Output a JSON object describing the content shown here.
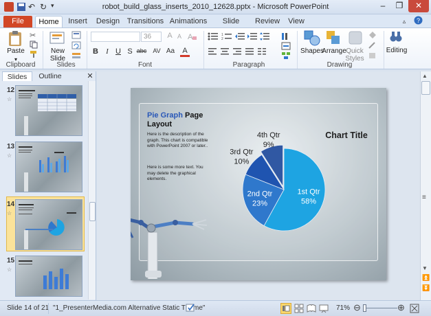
{
  "window": {
    "title": "robot_build_glass_inserts_2010_12628.pptx - Microsoft PowerPoint",
    "minimize_icon": "minimize-icon",
    "restore_icon": "restore-icon",
    "close_icon": "close-icon"
  },
  "ribbon_tabs": [
    "File",
    "Home",
    "Insert",
    "Design",
    "Transitions",
    "Animations",
    "Slide Show",
    "Review",
    "View"
  ],
  "ribbon": {
    "groups": [
      "Clipboard",
      "Slides",
      "Font",
      "Paragraph",
      "Drawing"
    ],
    "paste_label": "Paste",
    "new_slide_label": "New Slide",
    "font_size": "36",
    "shapes_label": "Shapes",
    "arrange_label": "Arrange",
    "quick_styles_label": "Quick Styles",
    "editing_label": "Editing",
    "format_buttons": [
      "B",
      "I",
      "U",
      "S",
      "abc",
      "AV",
      "Aa",
      "A"
    ]
  },
  "pane_tabs": {
    "slides": "Slides",
    "outline": "Outline"
  },
  "thumbnails": [
    {
      "number": "12"
    },
    {
      "number": "13"
    },
    {
      "number": "14",
      "selected": true
    },
    {
      "number": "15"
    }
  ],
  "slide": {
    "title_blue": "Pie Graph",
    "title_black": " Page Layout",
    "desc1": "Here is the description of the graph.  This chart is compatible with PowerPoint 2007 or later..",
    "desc2": "Here is some more text.  You may delete the graphical elements.",
    "chart_title": "Chart Title"
  },
  "chart_data": {
    "type": "pie",
    "title": "Chart Title",
    "slices": [
      {
        "label": "1st Qtr",
        "value": 58,
        "pct": "58%",
        "color": "#1ea4e2"
      },
      {
        "label": "2nd Qtr",
        "value": 23,
        "pct": "23%",
        "color": "#2f78cc"
      },
      {
        "label": "3rd Qtr",
        "value": 10,
        "pct": "10%",
        "color": "#1f54b0"
      },
      {
        "label": "4th Qtr",
        "value": 9,
        "pct": "9%",
        "color": "#3058a3"
      }
    ]
  },
  "status": {
    "slide_info": "Slide 14 of 21",
    "theme": "\"1_PresenterMedia.com Alternative Static Theme\"",
    "zoom": "71%"
  }
}
